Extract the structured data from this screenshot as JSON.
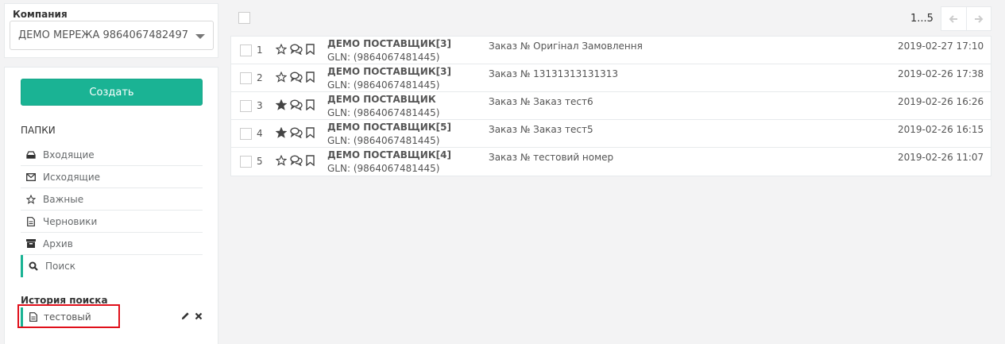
{
  "company": {
    "label": "Компания",
    "selected": "ДЕМО МЕРЕЖА 9864067482497"
  },
  "sidebar": {
    "create_label": "Создать",
    "folders_title": "ПАПКИ",
    "folders": [
      {
        "label": "Входящие",
        "icon": "inbox-icon"
      },
      {
        "label": "Исходящие",
        "icon": "envelope-icon"
      },
      {
        "label": "Важные",
        "icon": "star-icon"
      },
      {
        "label": "Черновики",
        "icon": "file-icon"
      },
      {
        "label": "Архив",
        "icon": "archive-icon"
      },
      {
        "label": "Поиск",
        "icon": "search-icon",
        "active": true
      }
    ],
    "history_title": "История поиска",
    "history_items": [
      {
        "label": "тестовый",
        "icon": "file-icon"
      }
    ]
  },
  "pager": {
    "range": "1...5"
  },
  "messages": [
    {
      "num": "1",
      "sender": "ДЕМО ПОСТАВЩИК[3]",
      "gln": "GLN: (9864067481445)",
      "subject": "Заказ № Оригінал Замовлення",
      "date": "2019-02-27 17:10",
      "starred": false
    },
    {
      "num": "2",
      "sender": "ДЕМО ПОСТАВЩИК[3]",
      "gln": "GLN: (9864067481445)",
      "subject": "Заказ № 13131313131313",
      "date": "2019-02-26 17:38",
      "starred": false
    },
    {
      "num": "3",
      "sender": "ДЕМО ПОСТАВЩИК",
      "gln": "GLN: (9864067481445)",
      "subject": "Заказ № Заказ тест6",
      "date": "2019-02-26 16:26",
      "starred": true
    },
    {
      "num": "4",
      "sender": "ДЕМО ПОСТАВЩИК[5]",
      "gln": "GLN: (9864067481445)",
      "subject": "Заказ № Заказ тест5",
      "date": "2019-02-26 16:15",
      "starred": true
    },
    {
      "num": "5",
      "sender": "ДЕМО ПОСТАВЩИК[4]",
      "gln": "GLN: (9864067481445)",
      "subject": "Заказ № тестовий номер",
      "date": "2019-02-26 11:07",
      "starred": false
    }
  ],
  "colors": {
    "accent": "#1ab394",
    "highlight": "#e0101b"
  }
}
